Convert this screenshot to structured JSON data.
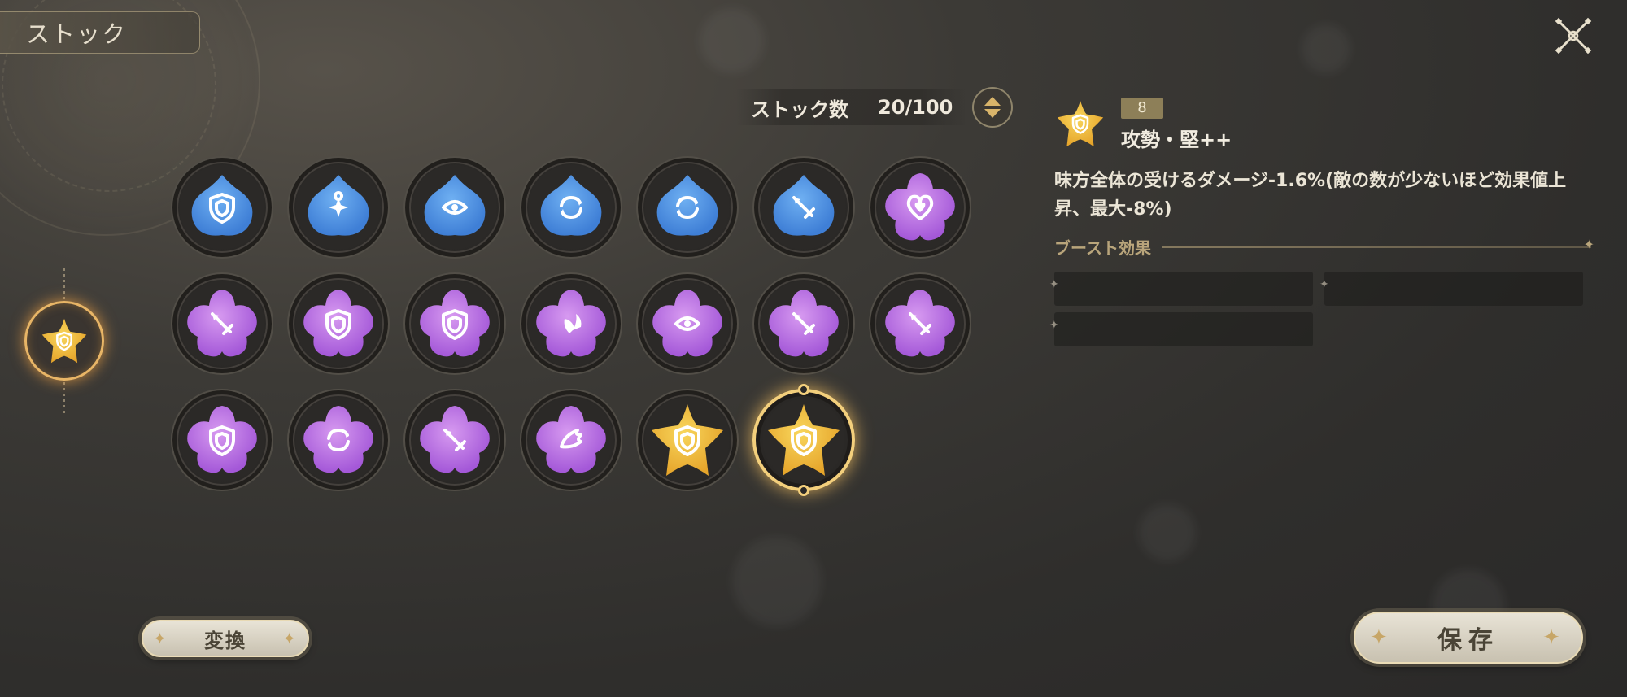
{
  "header": {
    "title": "ストック"
  },
  "stock": {
    "label": "ストック数",
    "value": "20/100"
  },
  "equipped": {
    "color": "gold",
    "emblem": "shield"
  },
  "grid": [
    {
      "color": "blue",
      "shape": "tri",
      "emblem": "shield"
    },
    {
      "color": "blue",
      "shape": "tri",
      "emblem": "sparkle"
    },
    {
      "color": "blue",
      "shape": "tri",
      "emblem": "eye"
    },
    {
      "color": "blue",
      "shape": "tri",
      "emblem": "cycle"
    },
    {
      "color": "blue",
      "shape": "tri",
      "emblem": "cycle"
    },
    {
      "color": "blue",
      "shape": "tri",
      "emblem": "sword"
    },
    {
      "color": "purple",
      "shape": "quad",
      "emblem": "heart"
    },
    {
      "color": "purple",
      "shape": "quad",
      "emblem": "sword"
    },
    {
      "color": "purple",
      "shape": "quad",
      "emblem": "shield"
    },
    {
      "color": "purple",
      "shape": "quad",
      "emblem": "shield"
    },
    {
      "color": "purple",
      "shape": "quad",
      "emblem": "leaf"
    },
    {
      "color": "purple",
      "shape": "quad",
      "emblem": "eye"
    },
    {
      "color": "purple",
      "shape": "quad",
      "emblem": "sword"
    },
    {
      "color": "purple",
      "shape": "quad",
      "emblem": "sword"
    },
    {
      "color": "purple",
      "shape": "quad",
      "emblem": "shield"
    },
    {
      "color": "purple",
      "shape": "quad",
      "emblem": "cycle"
    },
    {
      "color": "purple",
      "shape": "quad",
      "emblem": "sword"
    },
    {
      "color": "purple",
      "shape": "quad",
      "emblem": "wing"
    },
    {
      "color": "gold",
      "shape": "star",
      "emblem": "shield"
    },
    {
      "color": "gold",
      "shape": "star",
      "emblem": "shield",
      "selected": true
    }
  ],
  "detail": {
    "rank": "8",
    "name": "攻勢・堅++",
    "description": "味方全体の受けるダメージ-1.6%(敵の数が少ないほど効果値上昇、最大-8%)",
    "boost_title": "ブースト効果"
  },
  "buttons": {
    "convert": "変換",
    "save": "保存"
  },
  "colors": {
    "blue": [
      "#3f7fd6",
      "#6fb0f2"
    ],
    "purple": [
      "#a458d8",
      "#d79af0"
    ],
    "gold": [
      "#e6a52b",
      "#f8d65c"
    ],
    "accent": "#e8c070"
  }
}
